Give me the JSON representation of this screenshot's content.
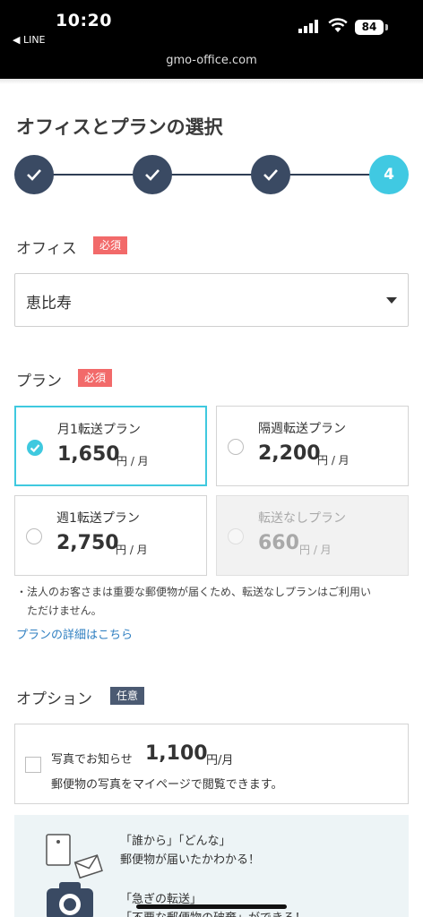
{
  "status_bar": {
    "time": "10:20",
    "back_app": "◀ LINE",
    "battery": "84",
    "url": "gmo-office.com"
  },
  "page": {
    "title": "オフィスとプランの選択"
  },
  "stepper": {
    "current_step": "4",
    "completed_steps": 3
  },
  "office": {
    "label": "オフィス",
    "badge": "必須",
    "selected": "恵比寿"
  },
  "plan": {
    "label": "プラン",
    "badge": "必須",
    "options": [
      {
        "name": "月1転送プラン",
        "price": "1,650",
        "unit": "円 / 月",
        "state": "selected"
      },
      {
        "name": "隔週転送プラン",
        "price": "2,200",
        "unit": "円 / 月",
        "state": "unselected"
      },
      {
        "name": "週1転送プラン",
        "price": "2,750",
        "unit": "円 / 月",
        "state": "unselected"
      },
      {
        "name": "転送なしプラン",
        "price": "660",
        "unit": "円 / 月",
        "state": "disabled"
      }
    ],
    "note_line1": "・法人のお客さまは重要な郵便物が届くため、転送なしプランはご利用い",
    "note_line2": "　ただけません。",
    "details_link": "プランの詳細はこちら"
  },
  "option": {
    "label": "オプション",
    "badge": "任意",
    "name": "写真でお知らせ",
    "price": "1,100",
    "unit": "円/月",
    "description": "郵便物の写真をマイページで閲覧できます。"
  },
  "promo": {
    "line1": "「誰から」「どんな」",
    "line2": "郵便物が届いたかわかる！",
    "line3": "「急ぎの転送」",
    "line4": "「不要な郵便物の破棄」ができる！"
  },
  "colors": {
    "accent": "#40c9e2",
    "step_done": "#3a4a63",
    "required": "#f26a6a",
    "optional": "#4b5a72",
    "link": "#2f7fc1"
  }
}
